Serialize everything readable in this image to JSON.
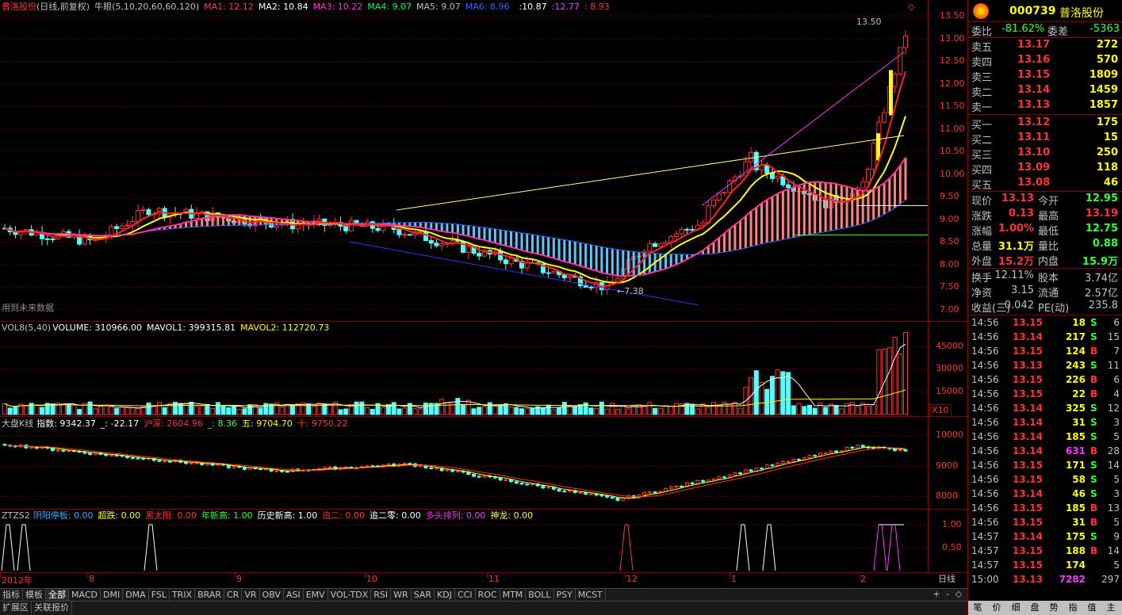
{
  "header": {
    "name": "普洛股份",
    "mode": "(日线,前复权)",
    "indicator": "牛眼(5,10,20,60,60,120)",
    "ma": [
      {
        "label": "MA1: 12.12",
        "color": "#ff3366"
      },
      {
        "label": "MA2: 10.84",
        "color": "#ffffff"
      },
      {
        "label": "MA3: 10.22",
        "color": "#ff33cc"
      },
      {
        "label": "MA4: 9.07",
        "color": "#00ff66"
      },
      {
        "label": "MA5: 9.07",
        "color": "#c0c0c0"
      },
      {
        "label": "MA6: 8.96",
        "color": "#3366ff"
      }
    ],
    "extra": [
      ":10.87",
      ":12.77",
      ": 8.93"
    ],
    "future_note": "用到未来数据",
    "high_label": "13.50",
    "low_label": "←7.38"
  },
  "price_axis": [
    "13.50",
    "13.00",
    "12.50",
    "12.00",
    "11.50",
    "11.00",
    "10.50",
    "10.00",
    "9.50",
    "9.00",
    "8.50",
    "8.00",
    "7.50",
    "7.00"
  ],
  "volume": {
    "title": "VOL8(5,40)",
    "values": "VOLUME: 310966.00",
    "mavol1": "MAVOL1: 399315.81",
    "mavol2": "MAVOL2: 112720.73",
    "axis": [
      "45000",
      "30000",
      "15000"
    ],
    "scale": "X10"
  },
  "index": {
    "title": "大盘K线",
    "zs": "指数: 9342.37",
    "chg": "_: -22.17",
    "hs": "沪深: 2604.96",
    "v1": "_: 8.36",
    "v2": "五: 9704.70",
    "v3": "十: 9750.22",
    "axis": [
      "10000",
      "9000",
      "8000"
    ]
  },
  "signal": {
    "title": "ZTZS2",
    "items": [
      {
        "label": "阴阳停板: 0.00",
        "color": "#33aaff"
      },
      {
        "label": "超跌: 0.00",
        "color": "#ffff00"
      },
      {
        "label": "黑太阳: 0.00",
        "color": "#ff3333"
      },
      {
        "label": "年新高: 1.00",
        "color": "#33ff33"
      },
      {
        "label": "历史新高: 1.00",
        "color": "#ffffff"
      },
      {
        "label": "追二: 0.00",
        "color": "#ff3333"
      },
      {
        "label": "追二零: 0.00",
        "color": "#ffffff"
      },
      {
        "label": "多头排列: 0.00",
        "color": "#ff33ff"
      },
      {
        "label": "神龙: 0.00",
        "color": "#ffff00"
      }
    ],
    "axis": [
      "1.00",
      "0.50"
    ]
  },
  "date_axis": [
    {
      "label": "2012年"
    },
    {
      "label": "8"
    },
    {
      "label": "9"
    },
    {
      "label": "10"
    },
    {
      "label": "11"
    },
    {
      "label": "12"
    },
    {
      "label": "1"
    },
    {
      "label": "2"
    }
  ],
  "period_label": "日线",
  "tabs": [
    "指标",
    "模板",
    "全部",
    "MACD",
    "DMI",
    "DMA",
    "FSL",
    "TRIX",
    "BRAR",
    "CR",
    "VR",
    "OBV",
    "ASI",
    "EMV",
    "VOL-TDX",
    "RSI",
    "WR",
    "SAR",
    "KDJ",
    "CCI",
    "ROC",
    "MTM",
    "BOLL",
    "PSY",
    "MCST"
  ],
  "bottom_tabs": [
    "扩展区",
    "关联报价"
  ],
  "zoom_buttons": [
    "+",
    "-",
    "◇"
  ],
  "quote": {
    "code": "000739",
    "name": "普洛股份",
    "ratio_label": "委比",
    "ratio": "-81.62%",
    "diff_label": "委差",
    "diff": "-5363",
    "sell": [
      {
        "label": "卖五",
        "price": "13.17",
        "vol": "272"
      },
      {
        "label": "卖四",
        "price": "13.16",
        "vol": "570"
      },
      {
        "label": "卖三",
        "price": "13.15",
        "vol": "1809"
      },
      {
        "label": "卖二",
        "price": "13.14",
        "vol": "1459"
      },
      {
        "label": "卖一",
        "price": "13.13",
        "vol": "1857"
      }
    ],
    "buy": [
      {
        "label": "买一",
        "price": "13.12",
        "vol": "175"
      },
      {
        "label": "买二",
        "price": "13.11",
        "vol": "15"
      },
      {
        "label": "买三",
        "price": "13.10",
        "vol": "250"
      },
      {
        "label": "买四",
        "price": "13.09",
        "vol": "118"
      },
      {
        "label": "买五",
        "price": "13.08",
        "vol": "46"
      }
    ],
    "stats": [
      {
        "l1": "现价",
        "v1": "13.13",
        "c1": "#ff3333",
        "l2": "今开",
        "v2": "12.95",
        "c2": "#33ff33"
      },
      {
        "l1": "涨跌",
        "v1": "0.13",
        "c1": "#ff3333",
        "l2": "最高",
        "v2": "13.19",
        "c2": "#ff3333"
      },
      {
        "l1": "涨幅",
        "v1": "1.00%",
        "c1": "#ff3333",
        "l2": "最低",
        "v2": "12.75",
        "c2": "#33ff33"
      },
      {
        "l1": "总量",
        "v1": "31.1万",
        "c1": "#ffff00",
        "l2": "量比",
        "v2": "0.88",
        "c2": "#33ff33"
      },
      {
        "l1": "外盘",
        "v1": "15.2万",
        "c1": "#ff3333",
        "l2": "内盘",
        "v2": "15.9万",
        "c2": "#33ff33"
      }
    ],
    "stats2": [
      {
        "l1": "换手",
        "v1": "12.11%",
        "l2": "股本",
        "v2": "3.74亿"
      },
      {
        "l1": "净资",
        "v1": "3.15",
        "l2": "流通",
        "v2": "2.57亿"
      },
      {
        "l1": "收益(三)",
        "v1": "0.042",
        "l2": "PE(动)",
        "v2": "235.8"
      }
    ],
    "ticks": [
      {
        "t": "14:56",
        "p": "13.15",
        "v": "18",
        "bs": "S",
        "n": "6"
      },
      {
        "t": "14:56",
        "p": "13.14",
        "v": "217",
        "bs": "S",
        "n": "15"
      },
      {
        "t": "14:56",
        "p": "13.15",
        "v": "124",
        "bs": "B",
        "n": "7"
      },
      {
        "t": "14:56",
        "p": "13.13",
        "v": "243",
        "bs": "S",
        "n": "11"
      },
      {
        "t": "14:56",
        "p": "13.15",
        "v": "226",
        "bs": "B",
        "n": "6"
      },
      {
        "t": "14:56",
        "p": "13.15",
        "v": "22",
        "bs": "B",
        "n": "4"
      },
      {
        "t": "14:56",
        "p": "13.14",
        "v": "325",
        "bs": "S",
        "n": "12"
      },
      {
        "t": "14:56",
        "p": "13.14",
        "v": "31",
        "bs": "S",
        "n": "3"
      },
      {
        "t": "14:56",
        "p": "13.14",
        "v": "185",
        "bs": "S",
        "n": "5"
      },
      {
        "t": "14:56",
        "p": "13.14",
        "v": "631",
        "bs": "B",
        "n": "28"
      },
      {
        "t": "14:56",
        "p": "13.15",
        "v": "171",
        "bs": "S",
        "n": "14"
      },
      {
        "t": "14:56",
        "p": "13.15",
        "v": "58",
        "bs": "S",
        "n": "5"
      },
      {
        "t": "14:56",
        "p": "13.14",
        "v": "46",
        "bs": "S",
        "n": "3"
      },
      {
        "t": "14:56",
        "p": "13.15",
        "v": "185",
        "bs": "B",
        "n": "13"
      },
      {
        "t": "14:56",
        "p": "13.15",
        "v": "31",
        "bs": "B",
        "n": "5"
      },
      {
        "t": "14:57",
        "p": "13.14",
        "v": "175",
        "bs": "S",
        "n": "9"
      },
      {
        "t": "14:57",
        "p": "13.15",
        "v": "188",
        "bs": "B",
        "n": "14"
      },
      {
        "t": "14:57",
        "p": "13.15",
        "v": "174",
        "bs": "",
        "n": "5"
      },
      {
        "t": "15:00",
        "p": "13.13",
        "v": "7282",
        "bs": "",
        "n": "297"
      }
    ],
    "bottom_tabs": [
      "笔",
      "价",
      "细",
      "盘",
      "势",
      "指",
      "值",
      "主"
    ]
  }
}
